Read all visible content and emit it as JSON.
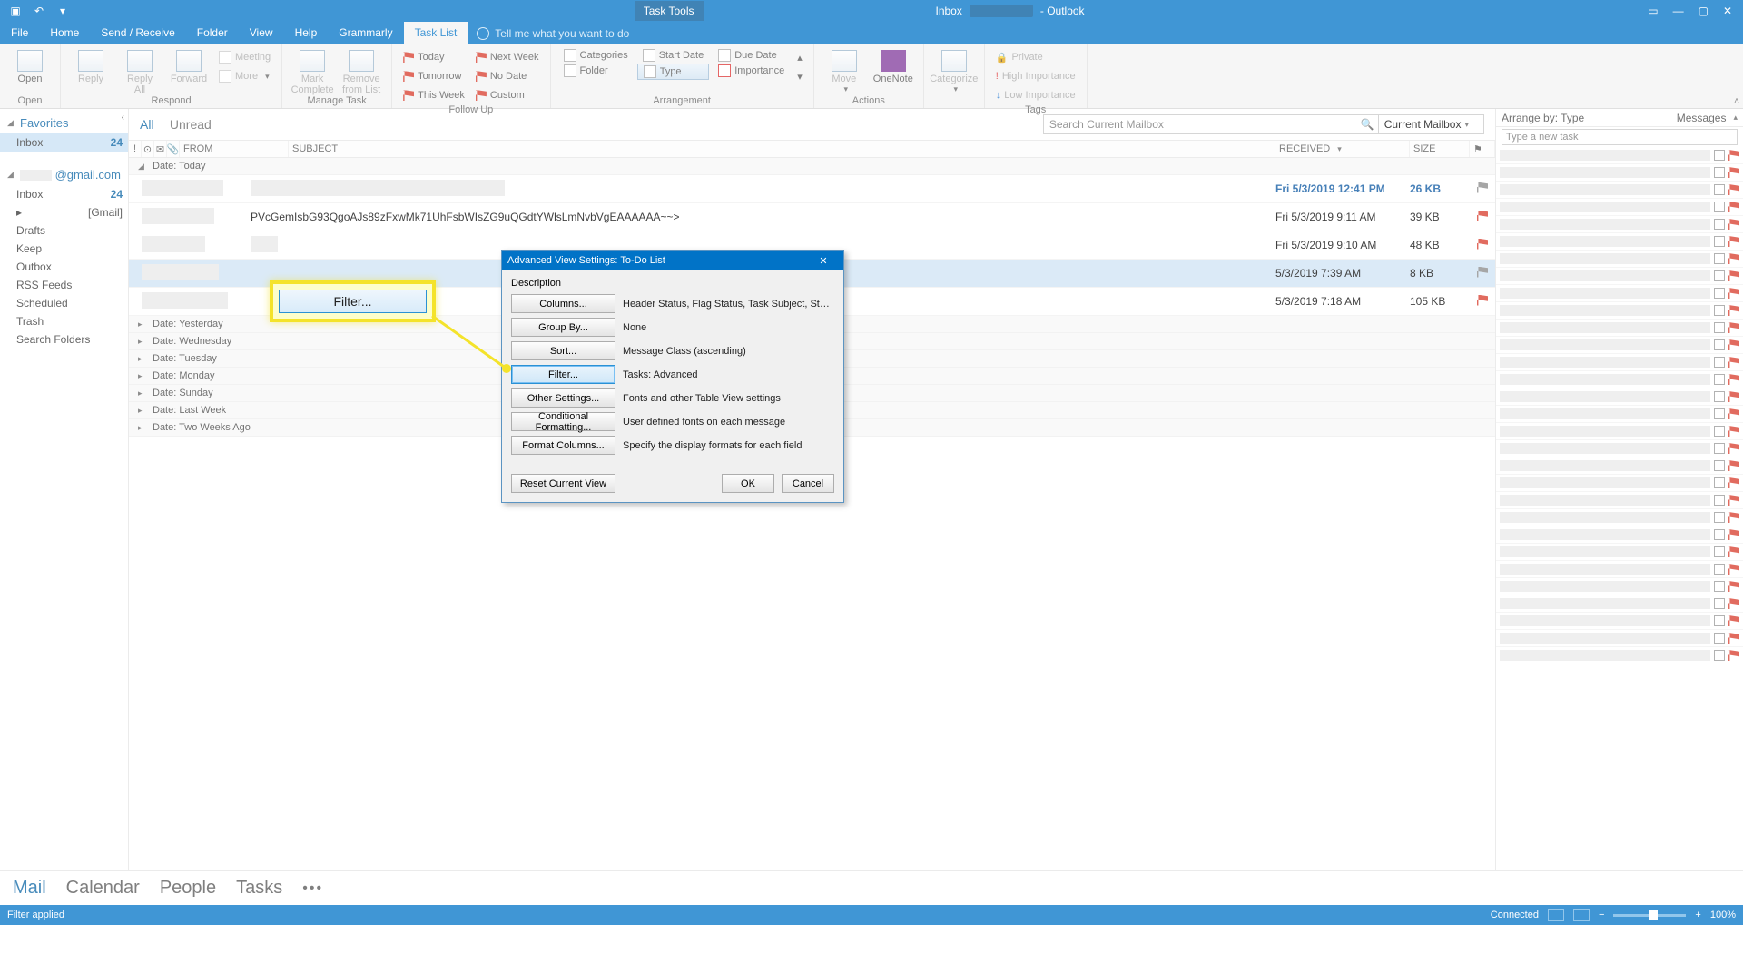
{
  "titlebar": {
    "task_tools": "Task Tools",
    "center_left": "Inbox",
    "center_right": "- Outlook"
  },
  "tabs": {
    "file": "File",
    "home": "Home",
    "sendreceive": "Send / Receive",
    "folder": "Folder",
    "view": "View",
    "help": "Help",
    "grammarly": "Grammarly",
    "tasklist": "Task List",
    "tellme": "Tell me what you want to do"
  },
  "ribbon": {
    "open": {
      "open": "Open",
      "group": "Open"
    },
    "respond": {
      "reply": "Reply",
      "replyall": "Reply\nAll",
      "forward": "Forward",
      "meeting": "Meeting",
      "more": "More",
      "group": "Respond"
    },
    "manage": {
      "mark": "Mark\nComplete",
      "remove": "Remove\nfrom List",
      "group": "Manage Task"
    },
    "followup": {
      "today": "Today",
      "tomorrow": "Tomorrow",
      "thisweek": "This Week",
      "nextweek": "Next Week",
      "nodate": "No Date",
      "custom": "Custom",
      "group": "Follow Up"
    },
    "arrangement": {
      "categories": "Categories",
      "startdate": "Start Date",
      "duedate": "Due Date",
      "folder": "Folder",
      "type": "Type",
      "importance": "Importance",
      "group": "Arrangement"
    },
    "actions": {
      "move": "Move",
      "onenote": "OneNote",
      "group": "Actions"
    },
    "categorize": {
      "categorize": "Categorize",
      "group": ""
    },
    "tags": {
      "private": "Private",
      "high": "High Importance",
      "low": "Low Importance",
      "group": "Tags"
    }
  },
  "nav": {
    "favorites": "Favorites",
    "inbox": "Inbox",
    "inbox_count": "24",
    "account_suffix": "@gmail.com",
    "gmail": "[Gmail]",
    "drafts": "Drafts",
    "keep": "Keep",
    "outbox": "Outbox",
    "rss": "RSS Feeds",
    "scheduled": "Scheduled",
    "trash": "Trash",
    "search": "Search Folders"
  },
  "content": {
    "all": "All",
    "unread": "Unread",
    "search_placeholder": "Search Current Mailbox",
    "scope": "Current Mailbox",
    "cols": {
      "from": "FROM",
      "subject": "SUBJECT",
      "received": "RECEIVED",
      "size": "SIZE"
    },
    "groups": {
      "today": "Date: Today",
      "yesterday": "Date: Yesterday",
      "wednesday": "Date: Wednesday",
      "tuesday": "Date: Tuesday",
      "monday": "Date: Monday",
      "sunday": "Date: Sunday",
      "lastweek": "Date: Last Week",
      "twoweeks": "Date: Two Weeks Ago"
    },
    "msgs": [
      {
        "recv": "Fri 5/3/2019 12:41 PM",
        "size": "26 KB",
        "unread": true
      },
      {
        "recv": "Fri 5/3/2019 9:11 AM",
        "size": "39 KB",
        "unread": false,
        "subj": "PVcGemIsbG93QgoAJs89zFxwMk71UhFsbWIsZG9uQGdtYWlsLmNvbVgEAAAAAA~~>"
      },
      {
        "recv": "Fri 5/3/2019 9:10 AM",
        "size": "48 KB",
        "unread": false
      },
      {
        "recv": "5/3/2019 7:39 AM",
        "size": "8 KB",
        "unread": false,
        "sel": true
      },
      {
        "recv": "5/3/2019 7:18 AM",
        "size": "105 KB",
        "unread": false
      }
    ]
  },
  "taskpane": {
    "arrange": "Arrange by: Type",
    "messages": "Messages",
    "newtask": "Type a new task"
  },
  "bottom": {
    "mail": "Mail",
    "calendar": "Calendar",
    "people": "People",
    "tasks": "Tasks"
  },
  "status": {
    "filter": "Filter applied",
    "connected": "Connected",
    "zoom": "100%"
  },
  "dialog": {
    "title": "Advanced View Settings: To-Do List",
    "description": "Description",
    "rows": [
      {
        "btn": "Columns...",
        "desc": "Header Status, Flag Status, Task Subject, Start Date, Rem..."
      },
      {
        "btn": "Group By...",
        "desc": "None"
      },
      {
        "btn": "Sort...",
        "desc": "Message Class (ascending)"
      },
      {
        "btn": "Filter...",
        "desc": "Tasks: Advanced",
        "hl": true
      },
      {
        "btn": "Other Settings...",
        "desc": "Fonts and other Table View settings"
      },
      {
        "btn": "Conditional Formatting...",
        "desc": "User defined fonts on each message"
      },
      {
        "btn": "Format Columns...",
        "desc": "Specify the display formats for each field"
      }
    ],
    "reset": "Reset Current View",
    "ok": "OK",
    "cancel": "Cancel"
  },
  "callout": {
    "label": "Filter..."
  }
}
